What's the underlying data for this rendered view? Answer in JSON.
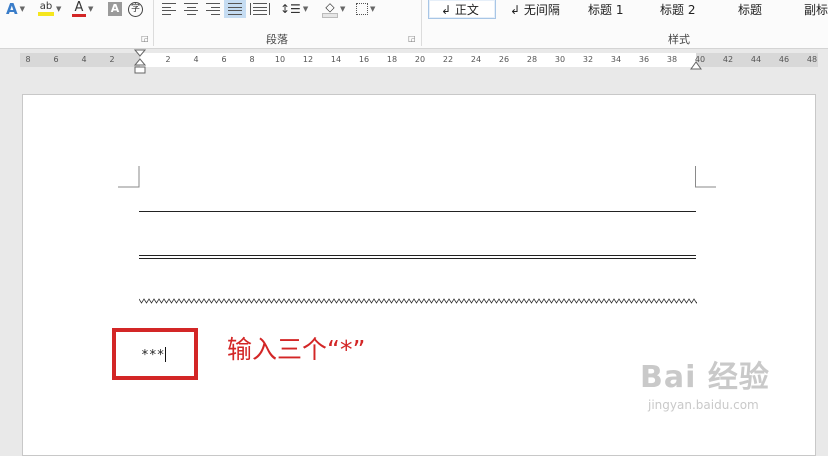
{
  "ribbon": {
    "groups": {
      "paragraph": "段落",
      "styles": "样式"
    },
    "font_tools": {
      "text_effect": "A",
      "highlight": "ab",
      "font_color": "A",
      "char_shading": "A",
      "enclose": "字"
    },
    "styles": [
      "↲ 正文",
      "↲ 无间隔",
      "标题 1",
      "标题 2",
      "标题",
      "副标"
    ]
  },
  "ruler": {
    "left": [
      "8",
      "6",
      "4",
      "2"
    ],
    "right": [
      "2",
      "4",
      "6",
      "8",
      "10",
      "12",
      "14",
      "16",
      "18",
      "20",
      "22",
      "24",
      "26",
      "28",
      "30",
      "32",
      "34",
      "36",
      "38",
      "40",
      "42",
      "44",
      "46",
      "48"
    ]
  },
  "document": {
    "typed_text": "***"
  },
  "annotation": {
    "text": "输入三个“*”"
  },
  "watermark": {
    "main": "Bai 经验",
    "url": "jingyan.baidu.com"
  },
  "colors": {
    "annotation_red": "#d32626",
    "highlight_yellow": "#f5e61d",
    "font_red": "#d32626"
  }
}
